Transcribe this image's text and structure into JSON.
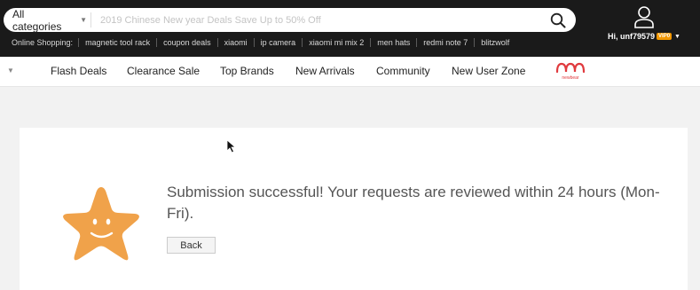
{
  "header": {
    "category_label": "All categories",
    "search_placeholder": "2019 Chinese New year Deals Save Up to 50% Off",
    "quick_label": "Online Shopping:",
    "quick_links": [
      "magnetic tool rack",
      "coupon deals",
      "xiaomi",
      "ip camera",
      "xiaomi mi mix 2",
      "men hats",
      "redmi note 7",
      "blitzwolf"
    ],
    "user_greeting": "Hi, unf79579",
    "vip_badge": "VIP0"
  },
  "nav": {
    "items": [
      "Flash Deals",
      "Clearance Sale",
      "Top Brands",
      "New Arrivals",
      "Community",
      "New User Zone"
    ],
    "brand_logo_text": "newbear"
  },
  "main": {
    "message": "Submission successful! Your requests are reviewed within 24 hours (Mon-Fri).",
    "back_label": "Back"
  },
  "colors": {
    "header_bg": "#1a1a1a",
    "star": "#f0a24a",
    "vip": "#f39800",
    "logo": "#e03a3e"
  }
}
